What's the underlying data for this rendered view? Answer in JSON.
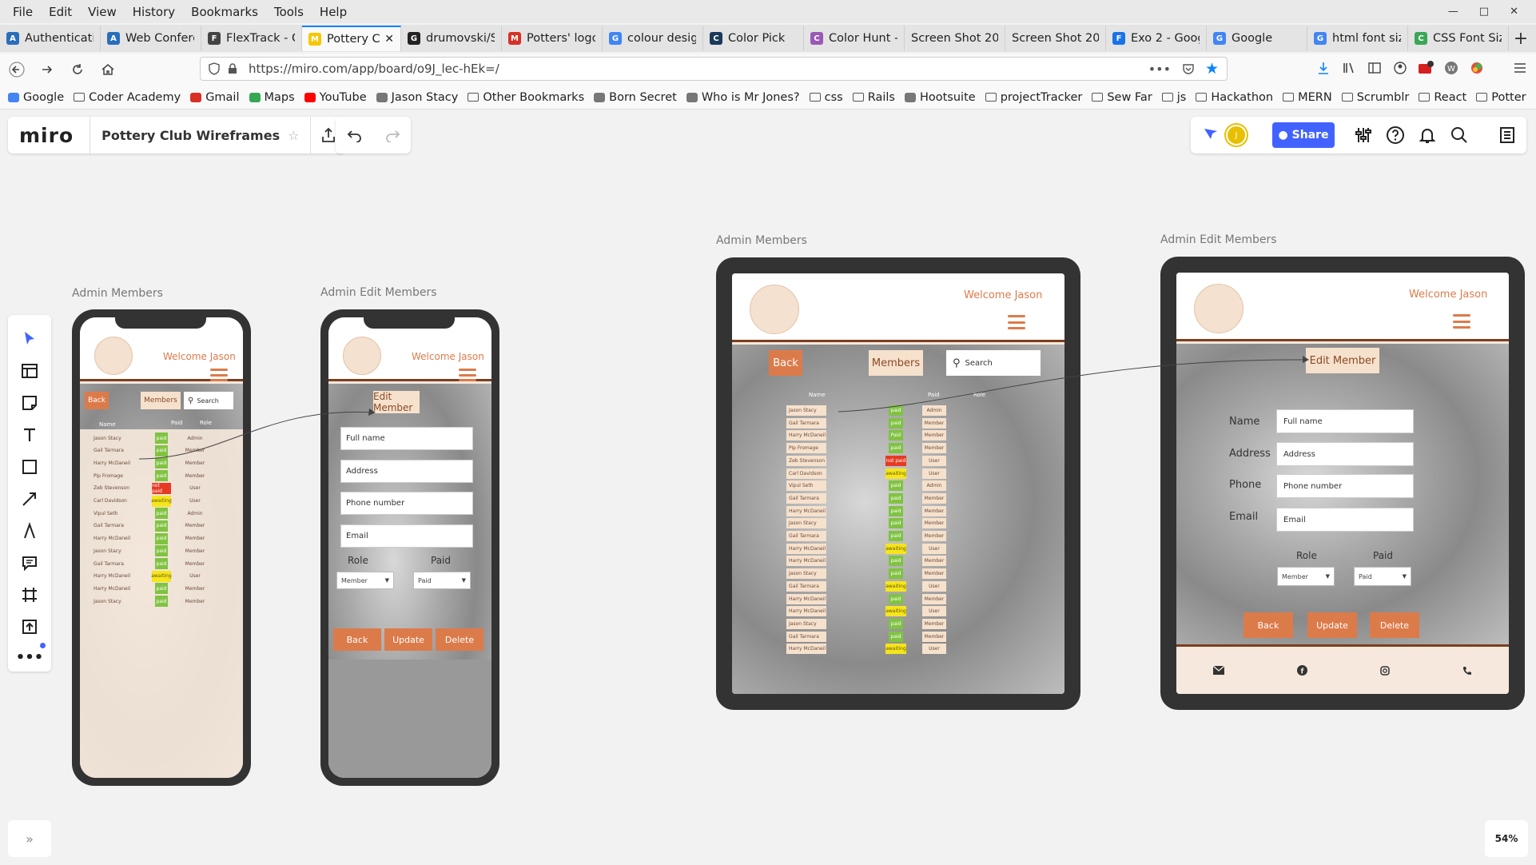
{
  "menu": [
    "File",
    "Edit",
    "View",
    "History",
    "Bookmarks",
    "Tools",
    "Help"
  ],
  "tabs": [
    {
      "label": "Authenticati",
      "color": "#2a6ebb",
      "glyph": "A"
    },
    {
      "label": "Web Confere",
      "color": "#2a6ebb",
      "glyph": "A"
    },
    {
      "label": "FlexTrack - C",
      "color": "#444",
      "glyph": "F"
    },
    {
      "label": "Pottery C",
      "color": "#f7c600",
      "glyph": "M",
      "active": true
    },
    {
      "label": "drumovski/S",
      "color": "#222",
      "glyph": "G"
    },
    {
      "label": "Potters' logo",
      "color": "#d93025",
      "glyph": "M"
    },
    {
      "label": "colour desig",
      "color": "#4285f4",
      "glyph": "G"
    },
    {
      "label": "Color Pick",
      "color": "#1b3a5a",
      "glyph": "C"
    },
    {
      "label": "Color Hunt -",
      "color": "#9b59b6",
      "glyph": "C"
    },
    {
      "label": "Screen Shot 202",
      "color": "#e4e4e4",
      "glyph": ""
    },
    {
      "label": "Screen Shot 202",
      "color": "#e4e4e4",
      "glyph": ""
    },
    {
      "label": "Exo 2 - Goog",
      "color": "#1a73e8",
      "glyph": "F"
    },
    {
      "label": "Google",
      "color": "#4285f4",
      "glyph": "G"
    },
    {
      "label": "html font siz",
      "color": "#4285f4",
      "glyph": "G"
    },
    {
      "label": "CSS Font Siz",
      "color": "#3aa757",
      "glyph": "C"
    }
  ],
  "url": "https://miro.com/app/board/o9J_lec-hEk=/",
  "bookmarks": [
    {
      "label": "Google",
      "type": "g"
    },
    {
      "label": "Coder Academy",
      "type": "f"
    },
    {
      "label": "Gmail",
      "type": "m"
    },
    {
      "label": "Maps",
      "type": "p"
    },
    {
      "label": "YouTube",
      "type": "y"
    },
    {
      "label": "Jason Stacy",
      "type": "o"
    },
    {
      "label": "Other Bookmarks",
      "type": "f"
    },
    {
      "label": "Born Secret",
      "type": "o"
    },
    {
      "label": "Who is Mr Jones?",
      "type": "o"
    },
    {
      "label": "css",
      "type": "f"
    },
    {
      "label": "Rails",
      "type": "f"
    },
    {
      "label": "Hootsuite",
      "type": "o"
    },
    {
      "label": "projectTracker",
      "type": "f"
    },
    {
      "label": "Sew Far",
      "type": "f"
    },
    {
      "label": "js",
      "type": "f"
    },
    {
      "label": "Hackathon",
      "type": "f"
    },
    {
      "label": "MERN",
      "type": "f"
    },
    {
      "label": "Scrumblr",
      "type": "f"
    },
    {
      "label": "React",
      "type": "f"
    },
    {
      "label": "Potter",
      "type": "f"
    }
  ],
  "miro": {
    "logo": "miro",
    "board_name": "Pottery Club Wireframes",
    "share": "Share",
    "avatar": "J",
    "zoom": "54%"
  },
  "frames": {
    "f1": "Admin Members",
    "f2": "Admin Edit Members",
    "f3": "Admin Members",
    "f4": "Admin Edit Members"
  },
  "app": {
    "welcome": "Welcome Jason",
    "back": "Back",
    "members": "Members",
    "search": "Search",
    "col_name": "Name",
    "col_paid": "Paid",
    "col_role": "Role",
    "edit_member": "Edit Member",
    "field_labels": {
      "name": "Name",
      "address": "Address",
      "phone": "Phone",
      "email": "Email"
    },
    "fields": {
      "name": "Full name",
      "address": "Address",
      "phone": "Phone number",
      "email": "Email"
    },
    "role_label": "Role",
    "paid_label": "Paid",
    "role_value": "Member",
    "paid_value": "Paid",
    "update": "Update",
    "delete": "Delete"
  },
  "phone_rows": [
    {
      "name": "Jason Stacy",
      "paid": "paid",
      "role": "Admin"
    },
    {
      "name": "Gail Tarmara",
      "paid": "paid",
      "role": "Member"
    },
    {
      "name": "Harry McDaneil",
      "paid": "paid",
      "role": "Member"
    },
    {
      "name": "Pip Fromage",
      "paid": "paid",
      "role": "Member"
    },
    {
      "name": "Zeb Stevenson",
      "paid": "not paid",
      "role": "User"
    },
    {
      "name": "Carl Davidson",
      "paid": "awaiting",
      "role": "User"
    },
    {
      "name": "Vipul Seth",
      "paid": "paid",
      "role": "Admin"
    },
    {
      "name": "Gail Tarmara",
      "paid": "paid",
      "role": "Member"
    },
    {
      "name": "Harry McDaneil",
      "paid": "paid",
      "role": "Member"
    },
    {
      "name": "Jason Stacy",
      "paid": "paid",
      "role": "Member"
    },
    {
      "name": "Gail Tarmara",
      "paid": "paid",
      "role": "Member"
    },
    {
      "name": "Harry McDaneil",
      "paid": "awaiting",
      "role": "User"
    },
    {
      "name": "Harry McDaneil",
      "paid": "paid",
      "role": "Member"
    },
    {
      "name": "Jason Stacy",
      "paid": "paid",
      "role": "Member"
    }
  ],
  "tablet_rows": [
    {
      "name": "Jason Stacy",
      "paid": "paid",
      "role": "Admin"
    },
    {
      "name": "Gail Tarmara",
      "paid": "paid",
      "role": "Member"
    },
    {
      "name": "Harry McDaneil",
      "paid": "Paid",
      "role": "Member"
    },
    {
      "name": "Pip Fromage",
      "paid": "paid",
      "role": "Member"
    },
    {
      "name": "Zeb Stevenson",
      "paid": "not paid",
      "role": "User"
    },
    {
      "name": "Carl Davidson",
      "paid": "awaiting",
      "role": "User"
    },
    {
      "name": "Vipul Seth",
      "paid": "paid",
      "role": "Admin"
    },
    {
      "name": "Gail Tarmara",
      "paid": "paid",
      "role": "Member"
    },
    {
      "name": "Harry McDaneil",
      "paid": "paid",
      "role": "Member"
    },
    {
      "name": "Jason Stacy",
      "paid": "paid",
      "role": "Member"
    },
    {
      "name": "Gail Tarmara",
      "paid": "paid",
      "role": "Member"
    },
    {
      "name": "Harry McDaneil",
      "paid": "awaiting",
      "role": "User"
    },
    {
      "name": "Harry McDaneil",
      "paid": "paid",
      "role": "Member"
    },
    {
      "name": "Jason Stacy",
      "paid": "paid",
      "role": "Member"
    },
    {
      "name": "Gail Tarmara",
      "paid": "awaiting",
      "role": "User"
    },
    {
      "name": "Harry McDaneil",
      "paid": "paid",
      "role": "Member"
    },
    {
      "name": "Harry McDaneil",
      "paid": "awaiting",
      "role": "User"
    },
    {
      "name": "Jason Stacy",
      "paid": "paid",
      "role": "Member"
    },
    {
      "name": "Gail Tarmara",
      "paid": "paid",
      "role": "Member"
    },
    {
      "name": "Harry McDaneil",
      "paid": "awaiting",
      "role": "User"
    }
  ],
  "colors": {
    "accent": "#dc7b4a",
    "brown": "#7b3f20",
    "cream": "#f6e8dc",
    "paid": "#80c342",
    "not_paid": "#e63a23",
    "awaiting": "#f5e51d",
    "miro_blue": "#4262ff"
  }
}
